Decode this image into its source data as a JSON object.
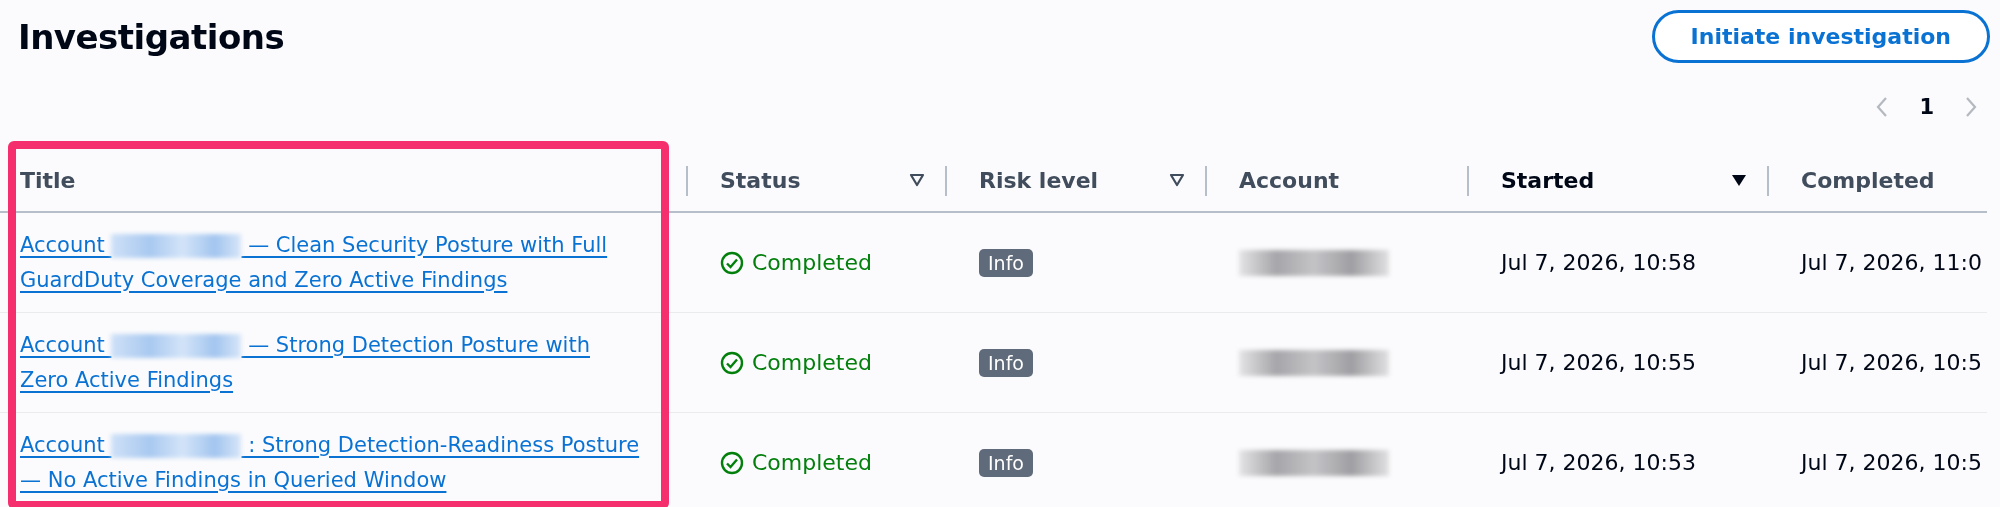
{
  "header": {
    "title": "Investigations",
    "action": "Initiate investigation"
  },
  "pagination": {
    "pages": [
      {
        "label": "1",
        "selected": true
      }
    ],
    "prev_disabled": true,
    "next_disabled": true
  },
  "table": {
    "columns": [
      {
        "label": "Title",
        "sortable": false,
        "sorted": false
      },
      {
        "label": "Status",
        "sortable": true,
        "sorted": false
      },
      {
        "label": "Risk level",
        "sortable": true,
        "sorted": false
      },
      {
        "label": "Account",
        "sortable": false,
        "sorted": false
      },
      {
        "label": "Started",
        "sortable": true,
        "sorted": true
      },
      {
        "label": "Completed",
        "sortable": false,
        "sorted": false
      }
    ],
    "rows": [
      {
        "title_start": "Account",
        "title_end": "— Clean Security Posture with Full GuardDuty Coverage and Zero Active Findings",
        "status": {
          "kind": "success",
          "label": "Completed"
        },
        "risk": "Info",
        "started": "Jul 7, 2026, 10:58",
        "completed": "Jul 7, 2026, 11:0"
      },
      {
        "title_start": "Account",
        "title_end": "— Strong Detection Posture with Zero Active Findings",
        "status": {
          "kind": "success",
          "label": "Completed"
        },
        "risk": "Info",
        "started": "Jul 7, 2026, 10:55",
        "completed": "Jul 7, 2026, 10:5"
      },
      {
        "title_start": "Account",
        "title_end": ": Strong Detection-Readiness Posture — No Active Findings in Queried Window",
        "status": {
          "kind": "success",
          "label": "Completed"
        },
        "risk": "Info",
        "started": "Jul 7, 2026, 10:53",
        "completed": "Jul 7, 2026, 10:5"
      }
    ]
  },
  "title_column_highlight": {
    "shown": true
  }
}
